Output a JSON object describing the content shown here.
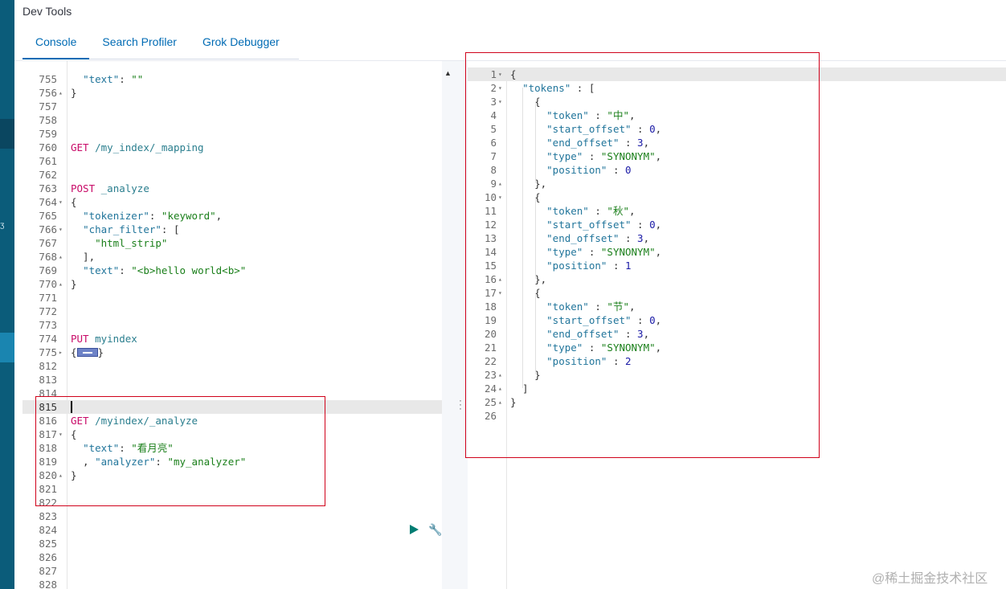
{
  "app": {
    "title": "Dev Tools"
  },
  "tabs": [
    {
      "label": "Console",
      "active": true
    },
    {
      "label": "Search Profiler",
      "active": false
    },
    {
      "label": "Grok Debugger",
      "active": false
    }
  ],
  "editor": {
    "lines": [
      {
        "num": "755",
        "fold": "",
        "segs": [
          [
            "p",
            "  "
          ],
          [
            "k",
            "\"text\""
          ],
          [
            "p",
            ": "
          ],
          [
            "s",
            "\"\""
          ]
        ]
      },
      {
        "num": "756",
        "fold": "▴",
        "segs": [
          [
            "p",
            "}"
          ]
        ]
      },
      {
        "num": "757",
        "fold": "",
        "segs": []
      },
      {
        "num": "758",
        "fold": "",
        "segs": []
      },
      {
        "num": "759",
        "fold": "",
        "segs": []
      },
      {
        "num": "760",
        "fold": "",
        "segs": [
          [
            "m",
            "GET"
          ],
          [
            "p",
            " "
          ],
          [
            "u",
            "/my_index/_mapping"
          ]
        ]
      },
      {
        "num": "761",
        "fold": "",
        "segs": []
      },
      {
        "num": "762",
        "fold": "",
        "segs": []
      },
      {
        "num": "763",
        "fold": "",
        "segs": [
          [
            "m",
            "POST"
          ],
          [
            "p",
            " "
          ],
          [
            "u",
            "_analyze"
          ]
        ]
      },
      {
        "num": "764",
        "fold": "▾",
        "segs": [
          [
            "p",
            "{"
          ]
        ]
      },
      {
        "num": "765",
        "fold": "",
        "segs": [
          [
            "p",
            "  "
          ],
          [
            "k",
            "\"tokenizer\""
          ],
          [
            "p",
            ": "
          ],
          [
            "s",
            "\"keyword\""
          ],
          [
            "p",
            ","
          ]
        ]
      },
      {
        "num": "766",
        "fold": "▾",
        "segs": [
          [
            "p",
            "  "
          ],
          [
            "k",
            "\"char_filter\""
          ],
          [
            "p",
            ": ["
          ]
        ]
      },
      {
        "num": "767",
        "fold": "",
        "segs": [
          [
            "p",
            "    "
          ],
          [
            "s",
            "\"html_strip\""
          ]
        ]
      },
      {
        "num": "768",
        "fold": "▴",
        "segs": [
          [
            "p",
            "  ],"
          ]
        ]
      },
      {
        "num": "769",
        "fold": "",
        "segs": [
          [
            "p",
            "  "
          ],
          [
            "k",
            "\"text\""
          ],
          [
            "p",
            ": "
          ],
          [
            "s",
            "\"<b>hello world<b>\""
          ]
        ]
      },
      {
        "num": "770",
        "fold": "▴",
        "segs": [
          [
            "p",
            "}"
          ]
        ]
      },
      {
        "num": "771",
        "fold": "",
        "segs": []
      },
      {
        "num": "772",
        "fold": "",
        "segs": []
      },
      {
        "num": "773",
        "fold": "",
        "segs": []
      },
      {
        "num": "774",
        "fold": "",
        "segs": [
          [
            "m",
            "PUT"
          ],
          [
            "p",
            " "
          ],
          [
            "u",
            "myindex"
          ]
        ]
      },
      {
        "num": "775",
        "fold": "▸",
        "segs": [
          [
            "p",
            "{"
          ],
          [
            "collapsed",
            ""
          ],
          [
            "p",
            "}"
          ]
        ]
      },
      {
        "num": "812",
        "fold": "",
        "segs": []
      },
      {
        "num": "813",
        "fold": "",
        "segs": []
      },
      {
        "num": "814",
        "fold": "",
        "segs": []
      },
      {
        "num": "815",
        "fold": "",
        "segs": [
          [
            "cursor",
            ""
          ]
        ],
        "highlight": true
      },
      {
        "num": "816",
        "fold": "",
        "segs": [
          [
            "m",
            "GET"
          ],
          [
            "p",
            " "
          ],
          [
            "u",
            "/myindex/_analyze"
          ]
        ]
      },
      {
        "num": "817",
        "fold": "▾",
        "segs": [
          [
            "p",
            "{"
          ]
        ]
      },
      {
        "num": "818",
        "fold": "",
        "segs": [
          [
            "p",
            "  "
          ],
          [
            "k",
            "\"text\""
          ],
          [
            "p",
            ": "
          ],
          [
            "s",
            "\"看月亮\""
          ]
        ]
      },
      {
        "num": "819",
        "fold": "",
        "segs": [
          [
            "p",
            "  , "
          ],
          [
            "k",
            "\"analyzer\""
          ],
          [
            "p",
            ": "
          ],
          [
            "s",
            "\"my_analyzer\""
          ]
        ]
      },
      {
        "num": "820",
        "fold": "▴",
        "segs": [
          [
            "p",
            "}"
          ]
        ]
      },
      {
        "num": "821",
        "fold": "",
        "segs": []
      },
      {
        "num": "822",
        "fold": "",
        "segs": []
      },
      {
        "num": "823",
        "fold": "",
        "segs": []
      },
      {
        "num": "824",
        "fold": "",
        "segs": []
      },
      {
        "num": "825",
        "fold": "",
        "segs": []
      },
      {
        "num": "826",
        "fold": "",
        "segs": []
      },
      {
        "num": "827",
        "fold": "",
        "segs": []
      },
      {
        "num": "828",
        "fold": "",
        "segs": []
      }
    ]
  },
  "output": {
    "lines": [
      {
        "num": "1",
        "fold": "▾",
        "segs": [
          [
            "p",
            "{"
          ]
        ],
        "highlight": true
      },
      {
        "num": "2",
        "fold": "▾",
        "segs": [
          [
            "p",
            "  "
          ],
          [
            "k",
            "\"tokens\""
          ],
          [
            "p",
            " : ["
          ]
        ]
      },
      {
        "num": "3",
        "fold": "▾",
        "segs": [
          [
            "p",
            "    {"
          ]
        ]
      },
      {
        "num": "4",
        "fold": "",
        "segs": [
          [
            "p",
            "      "
          ],
          [
            "k",
            "\"token\""
          ],
          [
            "p",
            " : "
          ],
          [
            "s",
            "\"中\""
          ],
          [
            "p",
            ","
          ]
        ]
      },
      {
        "num": "5",
        "fold": "",
        "segs": [
          [
            "p",
            "      "
          ],
          [
            "k",
            "\"start_offset\""
          ],
          [
            "p",
            " : "
          ],
          [
            "n",
            "0"
          ],
          [
            "p",
            ","
          ]
        ]
      },
      {
        "num": "6",
        "fold": "",
        "segs": [
          [
            "p",
            "      "
          ],
          [
            "k",
            "\"end_offset\""
          ],
          [
            "p",
            " : "
          ],
          [
            "n",
            "3"
          ],
          [
            "p",
            ","
          ]
        ]
      },
      {
        "num": "7",
        "fold": "",
        "segs": [
          [
            "p",
            "      "
          ],
          [
            "k",
            "\"type\""
          ],
          [
            "p",
            " : "
          ],
          [
            "s",
            "\"SYNONYM\""
          ],
          [
            "p",
            ","
          ]
        ]
      },
      {
        "num": "8",
        "fold": "",
        "segs": [
          [
            "p",
            "      "
          ],
          [
            "k",
            "\"position\""
          ],
          [
            "p",
            " : "
          ],
          [
            "n",
            "0"
          ]
        ]
      },
      {
        "num": "9",
        "fold": "▴",
        "segs": [
          [
            "p",
            "    },"
          ]
        ]
      },
      {
        "num": "10",
        "fold": "▾",
        "segs": [
          [
            "p",
            "    {"
          ]
        ]
      },
      {
        "num": "11",
        "fold": "",
        "segs": [
          [
            "p",
            "      "
          ],
          [
            "k",
            "\"token\""
          ],
          [
            "p",
            " : "
          ],
          [
            "s",
            "\"秋\""
          ],
          [
            "p",
            ","
          ]
        ]
      },
      {
        "num": "12",
        "fold": "",
        "segs": [
          [
            "p",
            "      "
          ],
          [
            "k",
            "\"start_offset\""
          ],
          [
            "p",
            " : "
          ],
          [
            "n",
            "0"
          ],
          [
            "p",
            ","
          ]
        ]
      },
      {
        "num": "13",
        "fold": "",
        "segs": [
          [
            "p",
            "      "
          ],
          [
            "k",
            "\"end_offset\""
          ],
          [
            "p",
            " : "
          ],
          [
            "n",
            "3"
          ],
          [
            "p",
            ","
          ]
        ]
      },
      {
        "num": "14",
        "fold": "",
        "segs": [
          [
            "p",
            "      "
          ],
          [
            "k",
            "\"type\""
          ],
          [
            "p",
            " : "
          ],
          [
            "s",
            "\"SYNONYM\""
          ],
          [
            "p",
            ","
          ]
        ]
      },
      {
        "num": "15",
        "fold": "",
        "segs": [
          [
            "p",
            "      "
          ],
          [
            "k",
            "\"position\""
          ],
          [
            "p",
            " : "
          ],
          [
            "n",
            "1"
          ]
        ]
      },
      {
        "num": "16",
        "fold": "▴",
        "segs": [
          [
            "p",
            "    },"
          ]
        ]
      },
      {
        "num": "17",
        "fold": "▾",
        "segs": [
          [
            "p",
            "    {"
          ]
        ]
      },
      {
        "num": "18",
        "fold": "",
        "segs": [
          [
            "p",
            "      "
          ],
          [
            "k",
            "\"token\""
          ],
          [
            "p",
            " : "
          ],
          [
            "s",
            "\"节\""
          ],
          [
            "p",
            ","
          ]
        ]
      },
      {
        "num": "19",
        "fold": "",
        "segs": [
          [
            "p",
            "      "
          ],
          [
            "k",
            "\"start_offset\""
          ],
          [
            "p",
            " : "
          ],
          [
            "n",
            "0"
          ],
          [
            "p",
            ","
          ]
        ]
      },
      {
        "num": "20",
        "fold": "",
        "segs": [
          [
            "p",
            "      "
          ],
          [
            "k",
            "\"end_offset\""
          ],
          [
            "p",
            " : "
          ],
          [
            "n",
            "3"
          ],
          [
            "p",
            ","
          ]
        ]
      },
      {
        "num": "21",
        "fold": "",
        "segs": [
          [
            "p",
            "      "
          ],
          [
            "k",
            "\"type\""
          ],
          [
            "p",
            " : "
          ],
          [
            "s",
            "\"SYNONYM\""
          ],
          [
            "p",
            ","
          ]
        ]
      },
      {
        "num": "22",
        "fold": "",
        "segs": [
          [
            "p",
            "      "
          ],
          [
            "k",
            "\"position\""
          ],
          [
            "p",
            " : "
          ],
          [
            "n",
            "2"
          ]
        ]
      },
      {
        "num": "23",
        "fold": "▴",
        "segs": [
          [
            "p",
            "    }"
          ]
        ]
      },
      {
        "num": "24",
        "fold": "▴",
        "segs": [
          [
            "p",
            "  ]"
          ]
        ]
      },
      {
        "num": "25",
        "fold": "▴",
        "segs": [
          [
            "p",
            "}"
          ]
        ]
      },
      {
        "num": "26",
        "fold": "",
        "segs": []
      }
    ]
  },
  "icons": {
    "scroll": "caret-up-icon",
    "split": "vertical-dots-icon",
    "run": "play-icon",
    "settings": "wrench-icon"
  },
  "watermark": "@稀土掘金技术社区"
}
